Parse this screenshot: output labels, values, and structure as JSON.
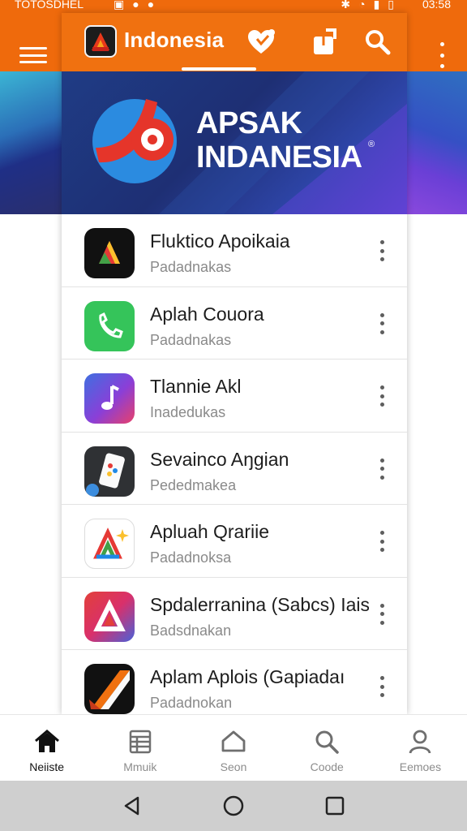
{
  "status_bar": {
    "carrier": "TOTOSDHEL",
    "time": "03:58"
  },
  "app_bar": {
    "title": "Indonesia",
    "menu_icon": "hamburger-menu-icon",
    "actions": [
      "favorite-icon",
      "share-icon",
      "search-icon",
      "more-vert-icon"
    ]
  },
  "banner": {
    "title": "APSAK\nINDANESIA",
    "reg_mark": "®"
  },
  "apps": [
    {
      "name": "Fluktico Apoikaia",
      "publisher": "Padadnakas",
      "icon": "triangle-logo-icon"
    },
    {
      "name": "Aplah Couora",
      "publisher": "Padadnakas",
      "icon": "phone-icon"
    },
    {
      "name": "Tlannie Akl",
      "publisher": "Inadedukas",
      "icon": "music-note-icon"
    },
    {
      "name": "Sevainco Aŋgian",
      "publisher": "Pededmakea",
      "icon": "phone-device-icon"
    },
    {
      "name": "Apluah Qrariie",
      "publisher": "Padadnoksa",
      "icon": "sparkle-a-icon"
    },
    {
      "name": "Spdalerranina (Sabcs) Iais",
      "publisher": "Badsdnakan",
      "icon": "triangle-a-icon"
    },
    {
      "name": "Aplam Aplois (Gapiadaı",
      "publisher": "Padadnokan",
      "icon": "slash-logo-icon"
    }
  ],
  "bottom_nav": [
    {
      "label": "Neiiste",
      "icon": "home-icon",
      "active": true
    },
    {
      "label": "Mmuik",
      "icon": "list-icon",
      "active": false
    },
    {
      "label": "Seon",
      "icon": "house-outline-icon",
      "active": false
    },
    {
      "label": "Coode",
      "icon": "search-icon",
      "active": false
    },
    {
      "label": "Eemoes",
      "icon": "person-icon",
      "active": false
    }
  ],
  "colors": {
    "accent": "#f07110",
    "banner_dark": "#1f3c85",
    "banner_purple": "#6a3fd8"
  }
}
